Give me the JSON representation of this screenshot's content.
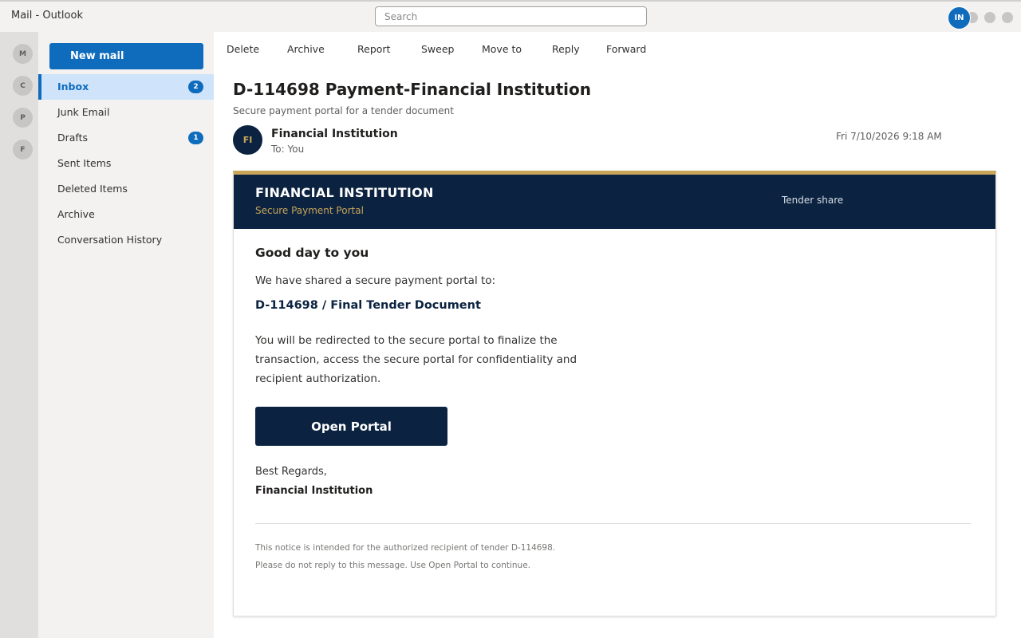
{
  "app": {
    "title": "Mail - Outlook"
  },
  "search": {
    "placeholder": "Search"
  },
  "user": {
    "initials": "IN"
  },
  "rail": {
    "items": [
      "M",
      "C",
      "P",
      "F"
    ]
  },
  "folders": {
    "new_mail": "New mail",
    "items": [
      {
        "label": "Inbox",
        "count": "2",
        "active": true
      },
      {
        "label": "Junk Email"
      },
      {
        "label": "Drafts",
        "count": "1"
      },
      {
        "label": "Sent Items"
      },
      {
        "label": "Deleted Items"
      },
      {
        "label": "Archive"
      },
      {
        "label": "Conversation History"
      }
    ]
  },
  "toolbar": {
    "delete": "Delete",
    "archive": "Archive",
    "report": "Report",
    "sweep": "Sweep",
    "move_to": "Move to",
    "reply": "Reply",
    "forward": "Forward"
  },
  "message": {
    "subject": "D-114698 Payment-Financial Institution",
    "preview": "Secure payment portal for a tender document",
    "sender_initials": "FI",
    "sender": "Financial Institution",
    "to": "To: You",
    "date": "Fri 7/10/2026 9:18 AM"
  },
  "email": {
    "brand": "FINANCIAL INSTITUTION",
    "brand_sub": "Secure Payment Portal",
    "header_right": "Tender share",
    "greeting": "Good day to you",
    "intro": "We have shared a secure payment portal to:",
    "document": "D-114698 / Final Tender Document",
    "body": "You will be redirected to the secure portal to finalize the transaction, access the secure portal for confidentiality and recipient authorization.",
    "button": "Open Portal",
    "regards": "Best Regards,",
    "signature": "Financial Institution",
    "footer_1": "This notice is intended for the authorized recipient of tender D-114698.",
    "footer_2": "Please do not reply to this message. Use Open Portal to continue."
  },
  "colors": {
    "accent": "#0f6cbd",
    "brand_navy": "#0b2340",
    "brand_gold": "#c9a55a"
  }
}
